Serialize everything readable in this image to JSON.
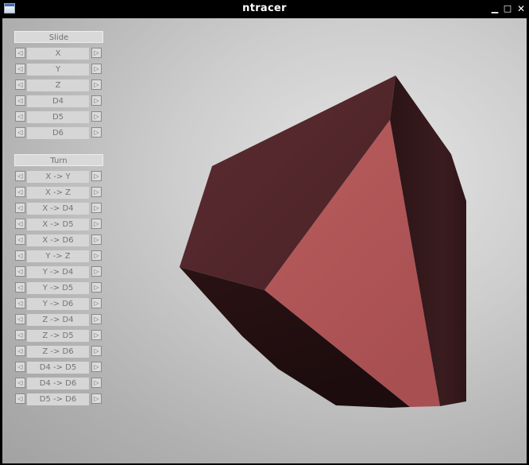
{
  "window": {
    "title": "ntracer",
    "minimize_glyph": "▁",
    "maximize_glyph": "□",
    "close_glyph": "✕"
  },
  "slide": {
    "title": "Slide",
    "items": [
      {
        "label": "X"
      },
      {
        "label": "Y"
      },
      {
        "label": "Z"
      },
      {
        "label": "D4"
      },
      {
        "label": "D5"
      },
      {
        "label": "D6"
      }
    ]
  },
  "turn": {
    "title": "Turn",
    "items": [
      {
        "label": "X -> Y"
      },
      {
        "label": "X -> Z"
      },
      {
        "label": "X -> D4"
      },
      {
        "label": "X -> D5"
      },
      {
        "label": "X -> D6"
      },
      {
        "label": "Y -> Z"
      },
      {
        "label": "Y -> D4"
      },
      {
        "label": "Y -> D5"
      },
      {
        "label": "Y -> D6"
      },
      {
        "label": "Z -> D4"
      },
      {
        "label": "Z -> D5"
      },
      {
        "label": "Z -> D6"
      },
      {
        "label": "D4 -> D5"
      },
      {
        "label": "D4 -> D6"
      },
      {
        "label": "D5 -> D6"
      }
    ]
  },
  "arrows": {
    "left": "◁",
    "right": "▷"
  },
  "colors": {
    "lit_face": "#b05757",
    "shadow_face": "#2e1517",
    "top_face": "#5a2b30",
    "background": "#c8c8c8"
  }
}
